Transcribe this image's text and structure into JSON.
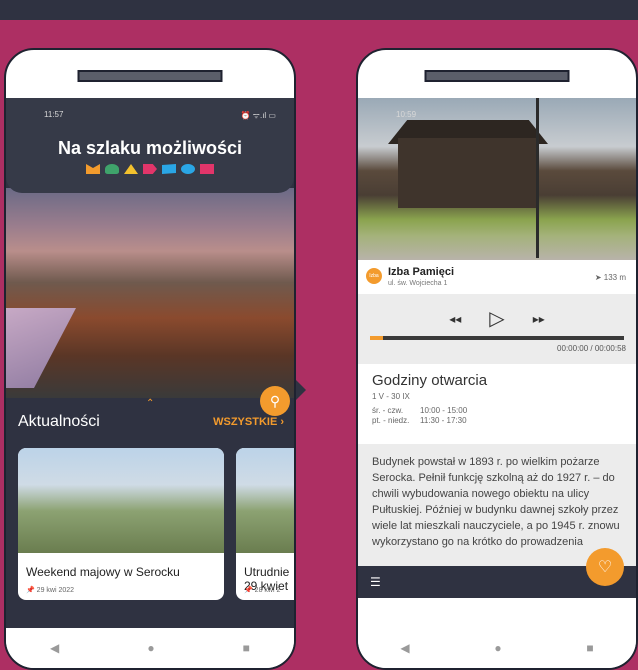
{
  "left_phone": {
    "status_time": "11:57",
    "status_icons": "⏰ ᯤ.ıl ▭",
    "app_title": "Na szlaku możliwości",
    "shape_colors": [
      "#f39b2d",
      "#3fa36b",
      "#f3c12d",
      "#e2356a",
      "#2aa6e6",
      "#2aa6e6",
      "#e2356a"
    ],
    "news_heading": "Aktualności",
    "news_all": "WSZYSTKIE ›",
    "cards": [
      {
        "title": "Weekend majowy w Serocku",
        "date": "29 kwi 2022"
      },
      {
        "title": "Utrudnie 29 kwiet",
        "date": "28 kwi 2"
      }
    ],
    "nav": [
      "◀",
      "●",
      "■"
    ]
  },
  "right_phone": {
    "status_time": "10:59",
    "place_name": "Izba Pamięci",
    "place_address": "ul. św. Wojciecha 1",
    "place_distance": "133 m",
    "pin_label": "Izba",
    "controls": {
      "rewind": "◂◂",
      "play": "▷",
      "forward": "▸▸"
    },
    "progress": 0.05,
    "audio_time": "00:00:00 / 00:00:58",
    "hours_heading": "Godziny otwarcia",
    "hours_range": "1 V - 30 IX",
    "hours_rows": [
      {
        "days": "śr. - czw.",
        "time": "10:00 - 15:00"
      },
      {
        "days": "pt. - niedz.",
        "time": "11:30 - 17:30"
      }
    ],
    "description": "Budynek powstał w 1893 r. po wielkim pożarze Serocka. Pełnił funkcję szkolną aż do 1927 r. – do chwili wybudowania nowego obiektu na ulicy Pułtuskiej. Później w budynku dawnej szkoły przez wiele lat mieszkali nauczyciele, a po 1945 r. znowu wykorzystano go na krótko do prowadzenia",
    "menu_icon": "☰",
    "nav": [
      "◀",
      "●",
      "■"
    ]
  }
}
